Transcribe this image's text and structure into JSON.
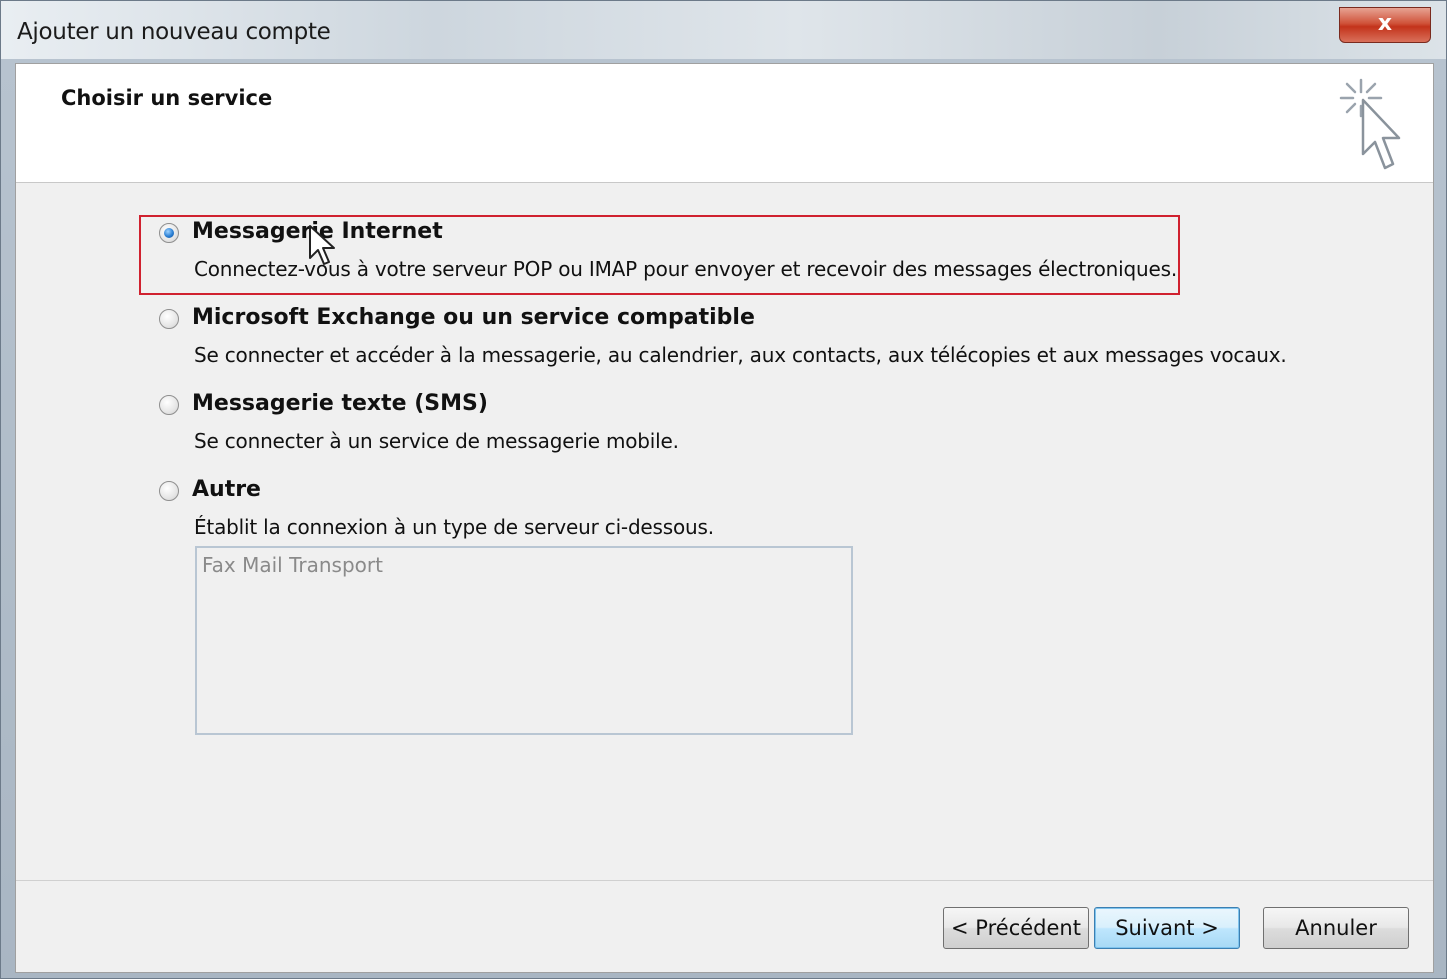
{
  "window": {
    "title": "Ajouter un nouveau compte",
    "close_label": "x"
  },
  "header": {
    "title": "Choisir un service",
    "icon": "pointer-sparkle-icon"
  },
  "options": [
    {
      "label": "Messagerie Internet",
      "description": "Connectez-vous à votre serveur POP ou IMAP pour envoyer et recevoir des messages électroniques.",
      "selected": true
    },
    {
      "label": "Microsoft Exchange ou un service compatible",
      "description": "Se connecter et accéder à la messagerie, au calendrier, aux contacts, aux télécopies et aux messages vocaux.",
      "selected": false
    },
    {
      "label": "Messagerie texte (SMS)",
      "description": "Se connecter à un service de messagerie mobile.",
      "selected": false
    },
    {
      "label": "Autre",
      "description": "Établit la connexion à un type de serveur ci-dessous.",
      "selected": false
    }
  ],
  "server_list": {
    "items": [
      "Fax Mail Transport"
    ]
  },
  "buttons": {
    "back": "< Précédent",
    "next": "Suivant >",
    "cancel": "Annuler"
  },
  "colors": {
    "highlight": "#d0212f",
    "default_button": "#bee6fd"
  }
}
